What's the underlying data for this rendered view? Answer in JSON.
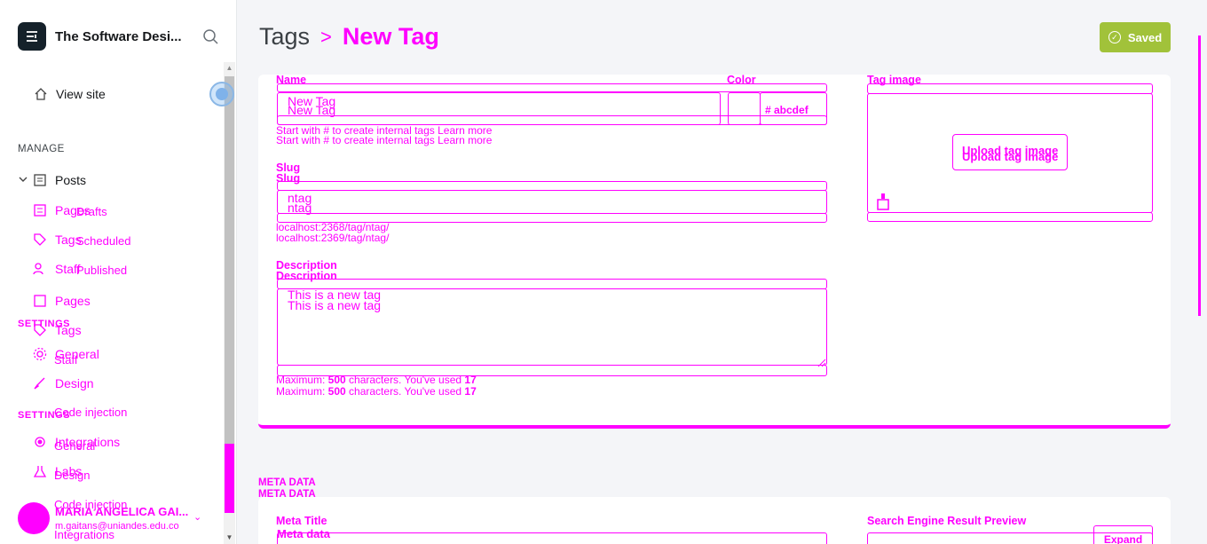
{
  "sidebar": {
    "site_title": "The Software Desi...",
    "view_site": "View site",
    "manage_label": "MANAGE",
    "posts": "Posts",
    "drafts": "Drafts",
    "scheduled": "Scheduled",
    "published": "Published",
    "pages": "Pages",
    "tags": "Tags",
    "staff": "Staff",
    "pages_ghost": "Pages",
    "tags_ghost": "Tags",
    "staff_ghost": "Staff",
    "settings_label": "SETTINGS",
    "general": "General",
    "design": "Design",
    "code_injection": "Code injection",
    "integrations": "Integrations",
    "labs": "Labs",
    "user_name": "MARIA ANGELICA GAI...",
    "user_email": "m.gaitans@uniandes.edu.co"
  },
  "header": {
    "breadcrumb_parent": "Tags",
    "breadcrumb_separator": ">",
    "breadcrumb_current": "New Tag",
    "saved_button": "Saved"
  },
  "form": {
    "name_label": "Name",
    "name_value": "New Tag",
    "color_label": "Color",
    "color_value": "# abcdef",
    "name_hint": "Start with # to create internal tags Learn more",
    "slug_label": "Slug",
    "slug_value": "ntag",
    "slug_url_1": "localhost:2368/tag/ntag/",
    "slug_url_2": "localhost:2369/tag/ntag/",
    "description_label": "Description",
    "description_value": "This is a new tag",
    "description_hint_prefix": "Maximum: ",
    "description_max": "500",
    "description_hint_mid": " characters. You've used ",
    "description_used": "17",
    "tag_image_label": "Tag image",
    "upload_button": "Upload tag image"
  },
  "meta": {
    "section_title": "META DATA",
    "meta_title_label": "Meta Title",
    "meta_title_value": "Meta data",
    "serp_label": "Search Engine Result Preview",
    "expand_button": "Expand"
  },
  "colors": {
    "accent": "#ff00ff",
    "saved_green": "#a1c23a",
    "brand_dark": "#15212a"
  }
}
